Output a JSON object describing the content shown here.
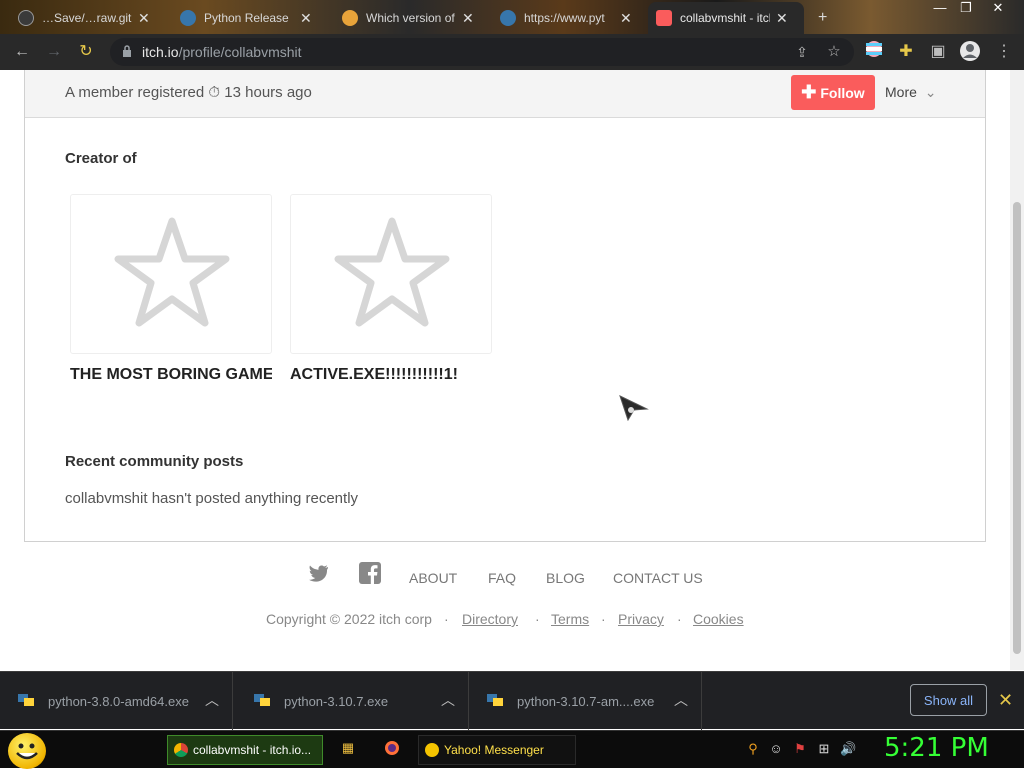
{
  "browser": {
    "tabs": [
      {
        "title": "…Save/…raw.github…",
        "active": false,
        "favicon_color": "#3a3a3a"
      },
      {
        "title": "Python Release",
        "active": false,
        "favicon_color": "#3776ab"
      },
      {
        "title": "Which version of",
        "active": false,
        "favicon_color": "#e8a33a"
      },
      {
        "title": "https://www.pyt",
        "active": false,
        "favicon_color": "#3776ab"
      },
      {
        "title": "collabvmshit - itch",
        "active": true,
        "favicon_color": "#fa5c5c"
      }
    ],
    "new_tab_label": "+",
    "url_host": "itch.io",
    "url_path": "/profile/collabvmshit"
  },
  "profile": {
    "member_text_prefix": "A member registered",
    "member_time": "13 hours ago",
    "follow_label": "Follow",
    "more_label": "More",
    "creator_of_title": "Creator of",
    "games": [
      {
        "title": "THE MOST BORING GAME"
      },
      {
        "title": "ACTIVE.EXE!!!!!!!!!!!1!"
      }
    ],
    "recent_posts_title": "Recent community posts",
    "no_posts_text": "collabvmshit hasn't posted anything recently"
  },
  "footer": {
    "links": [
      "ABOUT",
      "FAQ",
      "BLOG",
      "CONTACT US"
    ],
    "copyright": "Copyright © 2022 itch corp",
    "sub_links": [
      "Directory",
      "Terms",
      "Privacy",
      "Cookies"
    ],
    "separator": "·"
  },
  "downloads": {
    "items": [
      {
        "name": "python-3.8.0-amd64.exe"
      },
      {
        "name": "python-3.10.7.exe"
      },
      {
        "name": "python-3.10.7-am....exe"
      }
    ],
    "show_all_label": "Show all"
  },
  "taskbar": {
    "tasks": [
      {
        "label": "collabvmshit - itch.io..."
      },
      {
        "label": "Yahoo! Messenger"
      }
    ],
    "clock": "5:21 PM"
  },
  "colors": {
    "accent": "#fa5c5c",
    "clock": "#35ff35",
    "show_all_text": "#8ab4f8"
  }
}
